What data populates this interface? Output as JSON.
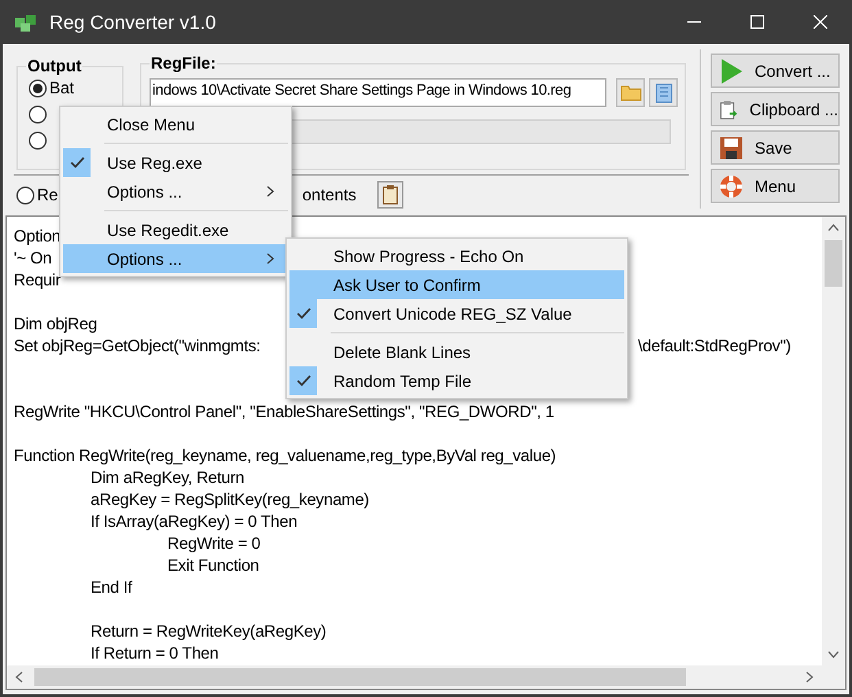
{
  "window": {
    "title": "Reg Converter v1.0"
  },
  "output": {
    "title": "Output",
    "options": [
      {
        "label": "Bat",
        "selected": true
      },
      {
        "selected": false
      },
      {
        "selected": false
      }
    ]
  },
  "regfile": {
    "title": "RegFile:",
    "value": "indows 10\\Activate Secret Share Settings Page in Windows 10.reg"
  },
  "actions": [
    {
      "kind": "convert",
      "label": "Convert ..."
    },
    {
      "kind": "clipboard",
      "label": "Clipboard ..."
    },
    {
      "kind": "save",
      "label": "Save"
    },
    {
      "kind": "menu",
      "label": "Menu"
    }
  ],
  "source_row": {
    "radio": {
      "label": "Re",
      "selected": false
    },
    "label_tail": "ontents"
  },
  "editor": {
    "lines": [
      {
        "kind": "text",
        "text": "Option"
      },
      {
        "kind": "text",
        "text": "'~ On"
      },
      {
        "kind": "text",
        "text": "Requir"
      },
      {
        "kind": "blank"
      },
      {
        "kind": "text",
        "text": "Dim objReg"
      },
      {
        "kind": "text",
        "text": "Set objReg=GetObject(\"winmgmts:",
        "tail": "\\default:StdRegProv\")"
      },
      {
        "kind": "blank"
      },
      {
        "kind": "blank"
      },
      {
        "kind": "text",
        "text": "RegWrite \"HKCU\\Control Panel\", \"EnableShareSettings\", \"REG_DWORD\", 1"
      },
      {
        "kind": "blank"
      },
      {
        "kind": "text",
        "text": "Function RegWrite(reg_keyname, reg_valuename,reg_type,ByVal reg_value)"
      },
      {
        "kind": "text",
        "text": "\tDim aRegKey, Return"
      },
      {
        "kind": "text",
        "text": "\taRegKey = RegSplitKey(reg_keyname)"
      },
      {
        "kind": "text",
        "text": "\tIf IsArray(aRegKey) = 0 Then"
      },
      {
        "kind": "text",
        "text": "\t\tRegWrite = 0"
      },
      {
        "kind": "text",
        "text": "\t\tExit Function"
      },
      {
        "kind": "text",
        "text": "\tEnd If"
      },
      {
        "kind": "blank"
      },
      {
        "kind": "text",
        "text": "\tReturn = RegWriteKey(aRegKey)"
      },
      {
        "kind": "text",
        "text": "\tIf Return = 0 Then"
      }
    ]
  },
  "context_menu": {
    "items": [
      {
        "kind": "item",
        "label": "Close Menu",
        "checked": false,
        "highlighted": false,
        "submenu": false
      },
      {
        "kind": "separator"
      },
      {
        "kind": "item",
        "label": "Use Reg.exe",
        "checked": true,
        "highlighted": false,
        "submenu": false
      },
      {
        "kind": "item",
        "label": "Options ...",
        "checked": false,
        "highlighted": false,
        "submenu": true
      },
      {
        "kind": "separator"
      },
      {
        "kind": "item",
        "label": "Use Regedit.exe",
        "checked": false,
        "highlighted": false,
        "submenu": false
      },
      {
        "kind": "item",
        "label": "Options ...",
        "checked": false,
        "highlighted": true,
        "submenu": true,
        "children": [
          {
            "kind": "item",
            "label": "Show Progress - Echo On",
            "checked": false,
            "highlighted": false,
            "submenu": false
          },
          {
            "kind": "item",
            "label": "Ask User to Confirm",
            "checked": false,
            "highlighted": true,
            "submenu": false
          },
          {
            "kind": "item",
            "label": "Convert Unicode REG_SZ Value",
            "checked": true,
            "highlighted": false,
            "submenu": false
          },
          {
            "kind": "separator"
          },
          {
            "kind": "item",
            "label": "Delete Blank Lines",
            "checked": false,
            "highlighted": false,
            "submenu": false
          },
          {
            "kind": "item",
            "label": "Random Temp File",
            "checked": true,
            "highlighted": false,
            "submenu": false
          }
        ]
      }
    ]
  }
}
